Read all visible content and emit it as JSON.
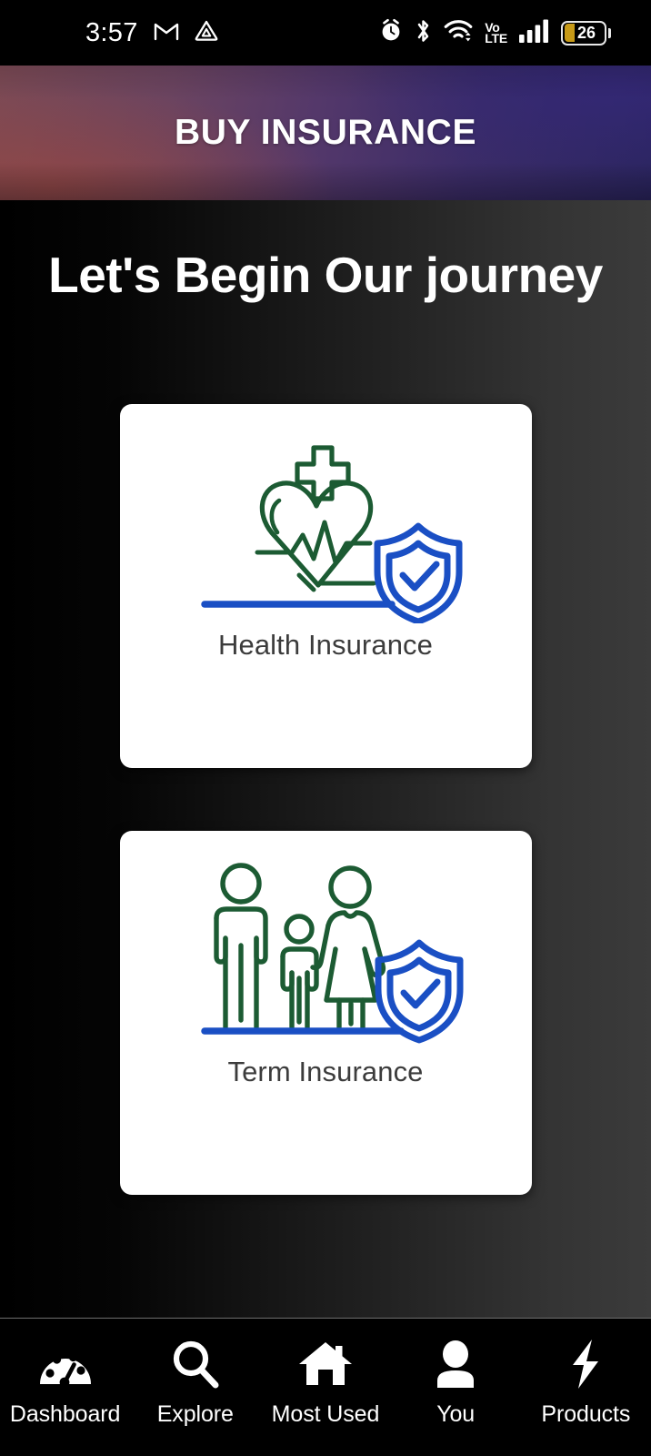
{
  "status_bar": {
    "time": "3:57",
    "left_icons": [
      {
        "name": "gmail-icon",
        "glyph": "M"
      },
      {
        "name": "triangle-app-icon",
        "glyph": "triangle"
      }
    ],
    "right_icons": [
      {
        "name": "alarm-clock-icon"
      },
      {
        "name": "bluetooth-icon"
      },
      {
        "name": "wifi-icon"
      },
      {
        "name": "volte-icon",
        "line1": "Vo",
        "line2": "LTE"
      },
      {
        "name": "cellular-signal-icon",
        "bars": 4
      }
    ],
    "battery": {
      "percent": "26",
      "level": 26,
      "fill_color": "#c79a17"
    }
  },
  "header": {
    "title": "BUY INSURANCE",
    "gradient_from": "#7c4a55",
    "gradient_to": "#2b2560"
  },
  "main": {
    "heading": "Let's Begin Our journey",
    "background_from": "#000000",
    "background_to": "#3b3b3b",
    "cards": [
      {
        "id": "health-insurance",
        "label": "Health Insurance",
        "icon": "heart-ecg-shield-illustration",
        "accent_green": "#1c5b33",
        "accent_blue": "#1a4fc4"
      },
      {
        "id": "term-insurance",
        "label": "Term Insurance",
        "icon": "family-shield-illustration",
        "accent_green": "#1c5b33",
        "accent_blue": "#1a4fc4"
      }
    ]
  },
  "bottom_nav": {
    "items": [
      {
        "id": "dashboard",
        "label": "Dashboard",
        "icon": "speedometer-icon"
      },
      {
        "id": "explore",
        "label": "Explore",
        "icon": "search-icon"
      },
      {
        "id": "most-used",
        "label": "Most Used",
        "icon": "home-icon"
      },
      {
        "id": "you",
        "label": "You",
        "icon": "person-icon"
      },
      {
        "id": "products",
        "label": "Products",
        "icon": "lightning-bolt-icon"
      }
    ]
  }
}
